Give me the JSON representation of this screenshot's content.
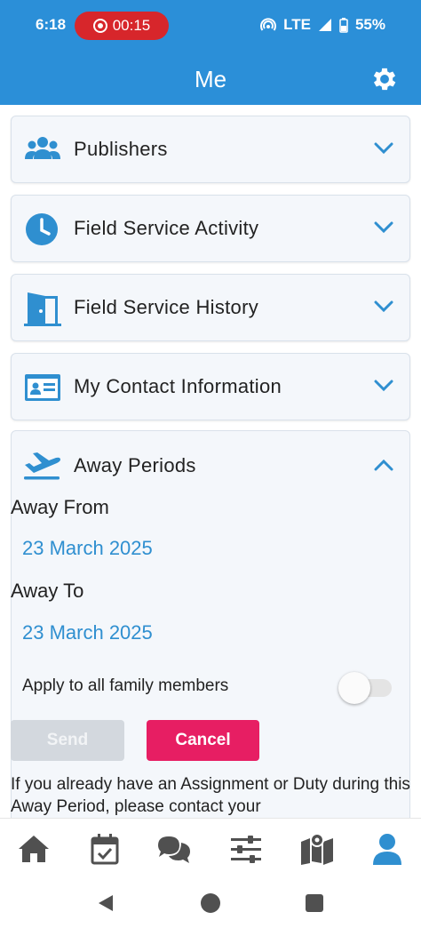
{
  "status_bar": {
    "time": "6:18",
    "recording": "00:15",
    "network": "LTE",
    "battery": "55%"
  },
  "app_bar": {
    "title": "Me",
    "settings_icon": "gear-icon"
  },
  "sections": [
    {
      "label": "Publishers",
      "icon": "users-icon",
      "expanded": false
    },
    {
      "label": "Field Service Activity",
      "icon": "clock-icon",
      "expanded": false
    },
    {
      "label": "Field Service History",
      "icon": "door-icon",
      "expanded": false
    },
    {
      "label": "My Contact Information",
      "icon": "id-card-icon",
      "expanded": false
    }
  ],
  "away_periods": {
    "label": "Away Periods",
    "icon": "plane-departure-icon",
    "expanded": true,
    "away_from_label": "Away From",
    "away_from_value": "23 March 2025",
    "away_to_label": "Away To",
    "away_to_value": "23 March 2025",
    "apply_family_label": "Apply to all family members",
    "apply_family_on": false,
    "send_label": "Send",
    "cancel_label": "Cancel",
    "info_text": "If you already have an Assignment or Duty during this Away Period, please contact your"
  },
  "bottom_nav": [
    {
      "icon": "home-icon"
    },
    {
      "icon": "calendar-check-icon"
    },
    {
      "icon": "chat-icon"
    },
    {
      "icon": "sliders-icon"
    },
    {
      "icon": "map-icon"
    },
    {
      "icon": "user-icon",
      "active": true
    }
  ],
  "colors": {
    "primary": "#2b8fd8",
    "accent": "#e71e63",
    "recording": "#d7262b",
    "date_text": "#2f8fd0",
    "nav_icon": "#505050"
  }
}
